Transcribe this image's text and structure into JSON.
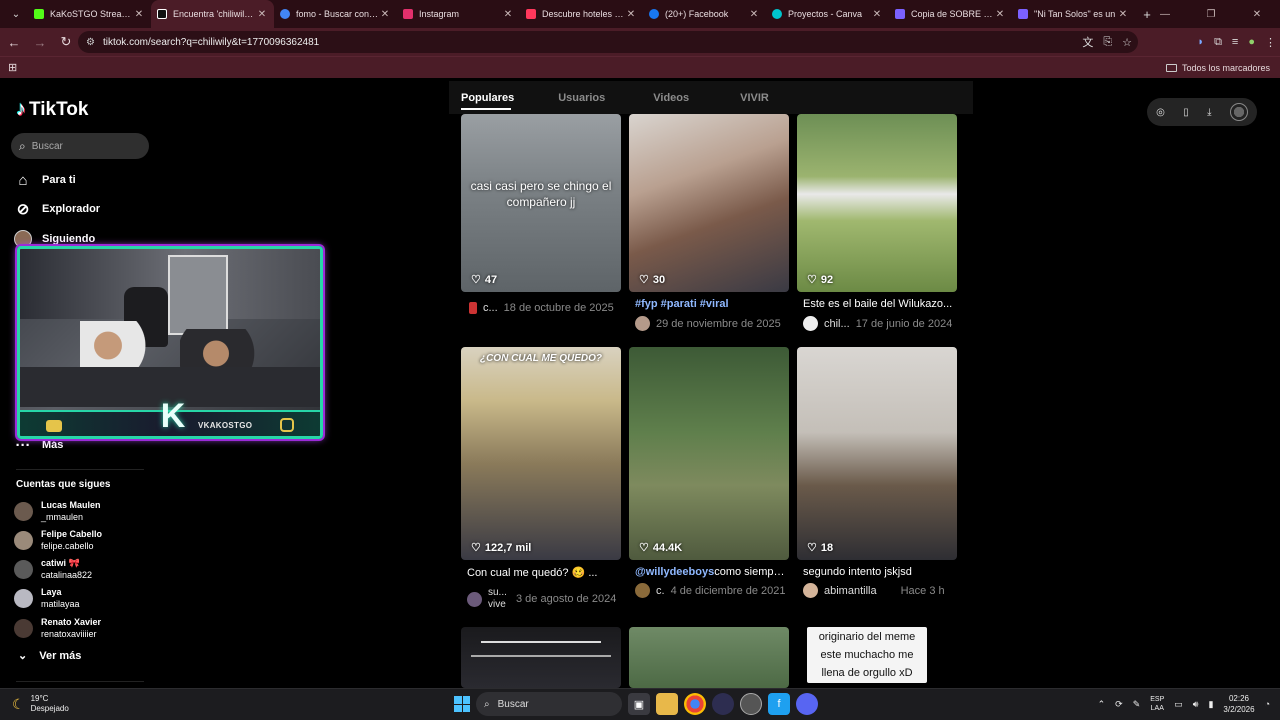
{
  "browser": {
    "tabs": [
      {
        "label": "KaKoSTGO Stream - Y",
        "color": "#53fc18"
      },
      {
        "label": "Encuentra 'chiliwily' e",
        "color": "#111111",
        "active": true
      },
      {
        "label": "fomo - Buscar con Go",
        "color": "#4285f4"
      },
      {
        "label": "Instagram",
        "color": "#e1306c"
      },
      {
        "label": "Descubre hoteles y al",
        "color": "#ff385c"
      },
      {
        "label": "(20+) Facebook",
        "color": "#1877f2"
      },
      {
        "label": "Proyectos - Canva",
        "color": "#00c4cc"
      },
      {
        "label": "Copia de SOBRE - Pre",
        "color": "#7b61ff"
      },
      {
        "label": "\"Ni Tan Solos\" es un",
        "color": "#7b61ff"
      }
    ],
    "url": "tiktok.com/search?q=chiliwily&t=1770096362481",
    "bookmarks_all": "Todos los marcadores"
  },
  "tiktok": {
    "logo": "TikTok",
    "search_placeholder": "Buscar",
    "nav": [
      {
        "label": "Para ti",
        "icon": "home-icon"
      },
      {
        "label": "Explorador",
        "icon": "compass-icon"
      },
      {
        "label": "Siguiendo",
        "icon": "following-avatar-icon"
      },
      {
        "label": "Más",
        "icon": "more-icon"
      }
    ],
    "following_header": "Cuentas que sigues",
    "following": [
      {
        "name": "Lucas Maulen",
        "handle": "_mmaulen"
      },
      {
        "name": "Felipe Cabello",
        "handle": "felipe.cabello"
      },
      {
        "name": "catiwi 🎀",
        "handle": "catalinaa822"
      },
      {
        "name": "Laya",
        "handle": "matilayaa"
      },
      {
        "name": "Renato Xavier",
        "handle": "renatoxaviiiier"
      }
    ],
    "see_more": "Ver más",
    "overlay_brand": "VKAKOSTGO",
    "tabs": [
      "Populares",
      "Usuarios",
      "Videos",
      "VIVIR"
    ],
    "videos": [
      {
        "likes": "47",
        "overlay_text": "casi casi pero se chingo el compañero jj",
        "caption_tag": "",
        "caption": "",
        "user": "c...",
        "date": "18 de octubre de 2025"
      },
      {
        "likes": "30",
        "overlay_text": "",
        "caption_tag": "#fyp #parati #viral",
        "caption": "",
        "user": "",
        "date": "29 de noviembre de 2025"
      },
      {
        "likes": "92",
        "overlay_text": "",
        "caption_tag": "",
        "caption": "Este es el baile del Wilukazo...",
        "user": "chil...",
        "date": "17 de junio de 2024"
      },
      {
        "likes": "122,7 mil",
        "overlay_text": "¿CON CUAL ME QUEDO?",
        "caption_tag": "",
        "caption": "Con cual me quedó? 🥴 ...",
        "user": "su... vive",
        "date": "3 de agosto de 2024"
      },
      {
        "likes": "44.4K",
        "overlay_text": "",
        "caption_tag": "@willydeeboys",
        "caption": "como siempr...",
        "user": "c.",
        "date": "4 de diciembre de 2021"
      },
      {
        "likes": "18",
        "overlay_text": "",
        "caption_tag": "",
        "caption": "segundo intento jskjsd",
        "user": "abimantilla",
        "date": "Hace 3 h"
      },
      {
        "likes": "",
        "overlay_text": "",
        "caption_tag": "",
        "caption": "",
        "user": "",
        "date": ""
      },
      {
        "likes": "",
        "overlay_text": "",
        "caption_tag": "",
        "caption": "",
        "user": "",
        "date": ""
      },
      {
        "likes": "",
        "overlay_text": "originario del meme este muchacho me llena de orgullo xD",
        "caption_tag": "",
        "caption": "",
        "user": "",
        "date": ""
      }
    ]
  },
  "taskbar": {
    "temp": "19°C",
    "weather": "Despejado",
    "search": "Buscar",
    "lang1": "ESP",
    "lang2": "LAA",
    "time": "02:26",
    "date": "3/2/2026"
  }
}
